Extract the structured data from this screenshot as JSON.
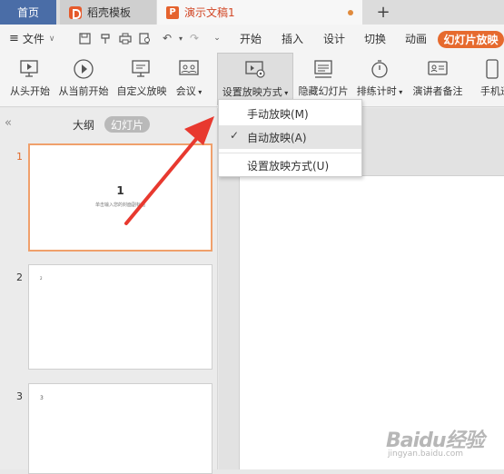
{
  "tabs": {
    "home": "首页",
    "template": "稻壳模板",
    "document": "演示文稿1",
    "add": "+"
  },
  "menubar": {
    "file": "文件",
    "items": [
      "开始",
      "插入",
      "设计",
      "切换",
      "动画"
    ],
    "active_tab": "幻灯片放映"
  },
  "ribbon": {
    "buttons": [
      {
        "label": "从头开始",
        "icon": "play-from-start-icon"
      },
      {
        "label": "从当前开始",
        "icon": "play-from-current-icon"
      },
      {
        "label": "自定义放映",
        "icon": "custom-show-icon"
      },
      {
        "label": "会议",
        "icon": "meeting-icon"
      },
      {
        "label": "设置放映方式",
        "icon": "slideshow-settings-icon"
      },
      {
        "label": "隐藏幻灯片",
        "icon": "hide-slide-icon"
      },
      {
        "label": "排练计时",
        "icon": "rehearse-timing-icon"
      },
      {
        "label": "演讲者备注",
        "icon": "speaker-notes-icon"
      },
      {
        "label": "手机遥",
        "icon": "phone-remote-icon"
      }
    ]
  },
  "dropdown": {
    "items": [
      {
        "label": "手动放映(M)",
        "checked": false
      },
      {
        "label": "自动放映(A)",
        "checked": true
      },
      {
        "label": "设置放映方式(U)",
        "checked": false
      }
    ]
  },
  "sidebar": {
    "outline_tab": "大纲",
    "slides_tab": "幻灯片",
    "slides": [
      {
        "number": "1",
        "title": "1",
        "subtitle": "单击输入您的封面副标题"
      },
      {
        "number": "2",
        "text": "2"
      },
      {
        "number": "3",
        "text": "3"
      }
    ]
  },
  "watermark": {
    "main": "Baidu经验",
    "sub": "jingyan.baidu.com"
  },
  "colors": {
    "accent": "#e66a2e",
    "home_tab": "#4a6da7",
    "arrow": "#e8392f"
  }
}
